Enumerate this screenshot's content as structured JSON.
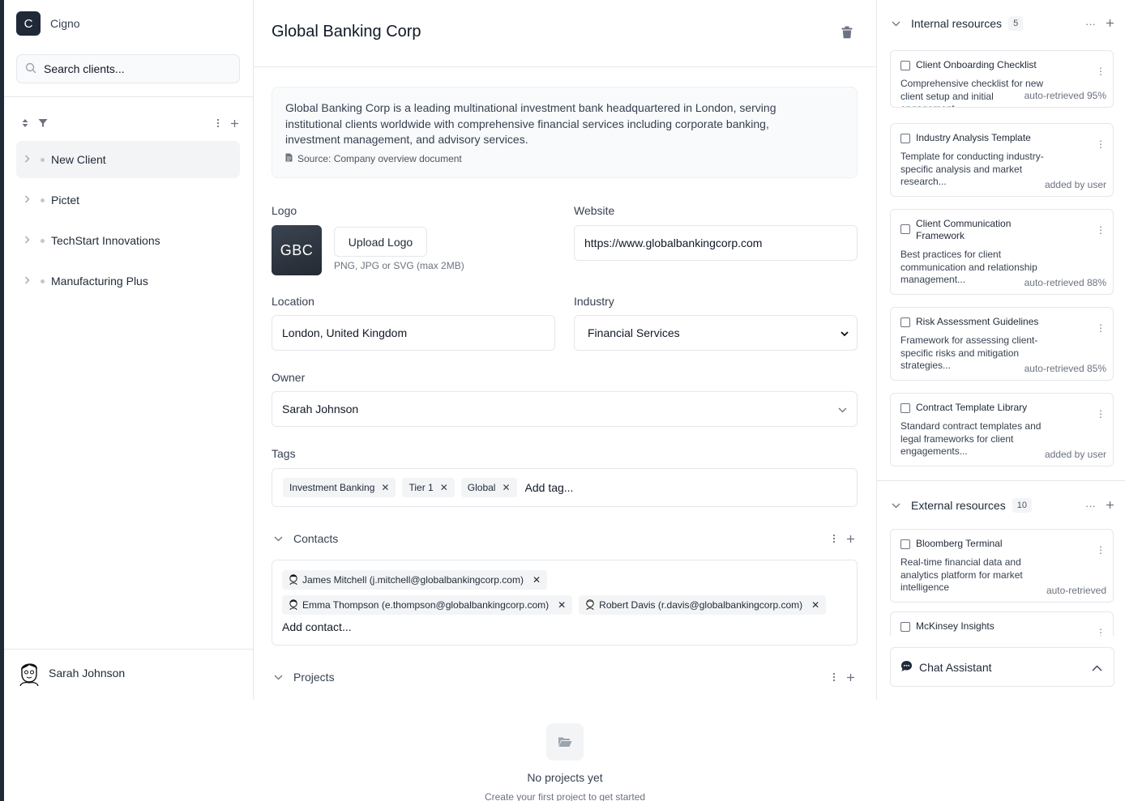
{
  "app": {
    "logo_letter": "C",
    "name": "Cigno"
  },
  "sidebar": {
    "search_text": "Search clients...",
    "clients": [
      {
        "label": "New Client",
        "active": true
      },
      {
        "label": "Pictet",
        "active": false
      },
      {
        "label": "TechStart Innovations",
        "active": false
      },
      {
        "label": "Manufacturing Plus",
        "active": false
      }
    ],
    "user_name": "Sarah Johnson"
  },
  "main": {
    "title": "Global Banking Corp",
    "description": "Global Banking Corp is a leading multinational investment bank headquartered in London, serving institutional clients worldwide with comprehensive financial services including corporate banking, investment management, and advisory services.",
    "source": "Source: Company overview document",
    "logo": {
      "label": "Logo",
      "initials": "GBC",
      "upload_label": "Upload Logo",
      "hint": "PNG, JPG or SVG (max 2MB)"
    },
    "website": {
      "label": "Website",
      "value": "https://www.globalbankingcorp.com"
    },
    "location": {
      "label": "Location",
      "value": "London, United Kingdom"
    },
    "industry": {
      "label": "Industry",
      "value": "Financial Services"
    },
    "owner": {
      "label": "Owner",
      "value": "Sarah Johnson"
    },
    "tags": {
      "label": "Tags",
      "items": [
        "Investment Banking",
        "Tier 1",
        "Global"
      ],
      "placeholder": "Add tag..."
    },
    "contacts": {
      "title": "Contacts",
      "items": [
        "James Mitchell (j.mitchell@globalbankingcorp.com)",
        "Emma Thompson (e.thompson@globalbankingcorp.com)",
        "Robert Davis (r.davis@globalbankingcorp.com)"
      ],
      "add_label": "Add contact..."
    },
    "projects": {
      "title": "Projects",
      "empty_title": "No projects yet",
      "empty_sub": "Create your first project to get started"
    }
  },
  "right_panel": {
    "internal": {
      "title": "Internal resources",
      "count": "5",
      "items": [
        {
          "title": "Client Onboarding Checklist",
          "desc": "Comprehensive checklist for new client setup and initial engagement...",
          "meta": "auto-retrieved 95%"
        },
        {
          "title": "Industry Analysis Template",
          "desc": "Template for conducting industry-specific analysis and market research...",
          "meta": "added by user"
        },
        {
          "title": "Client Communication Framework",
          "desc": "Best practices for client communication and relationship management...",
          "meta": "auto-retrieved 88%"
        },
        {
          "title": "Risk Assessment Guidelines",
          "desc": "Framework for assessing client-specific risks and mitigation strategies...",
          "meta": "auto-retrieved 85%"
        },
        {
          "title": "Contract Template Library",
          "desc": "Standard contract templates and legal frameworks for client engagements...",
          "meta": "added by user"
        }
      ]
    },
    "external": {
      "title": "External resources",
      "count": "10",
      "items": [
        {
          "title": "Bloomberg Terminal",
          "desc": "Real-time financial data and analytics platform for market intelligence",
          "meta": "auto-retrieved"
        },
        {
          "title": "McKinsey Insights",
          "desc": "",
          "meta": ""
        }
      ]
    },
    "chat_label": "Chat Assistant"
  }
}
